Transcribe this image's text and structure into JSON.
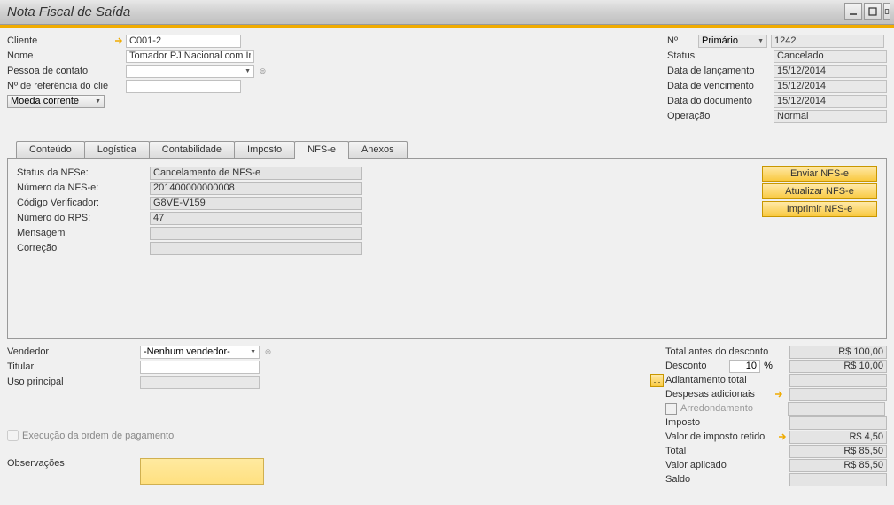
{
  "window": {
    "title": "Nota Fiscal de Saída"
  },
  "header_left": {
    "cliente": {
      "label": "Cliente",
      "value": "C001-2"
    },
    "nome": {
      "label": "Nome",
      "value": "Tomador PJ Nacional com Insc."
    },
    "pessoa": {
      "label": "Pessoa de contato",
      "value": ""
    },
    "ref": {
      "label": "Nº de referência do clie",
      "value": ""
    },
    "moeda": {
      "label": "Moeda corrente",
      "value": ""
    }
  },
  "header_right": {
    "numero": {
      "label": "Nº",
      "combo": "Primário",
      "value": "1242"
    },
    "status": {
      "label": "Status",
      "value": "Cancelado"
    },
    "data_lanc": {
      "label": "Data de lançamento",
      "value": "15/12/2014"
    },
    "data_venc": {
      "label": "Data de vencimento",
      "value": "15/12/2014"
    },
    "data_doc": {
      "label": "Data do documento",
      "value": "15/12/2014"
    },
    "operacao": {
      "label": "Operação",
      "value": "Normal"
    }
  },
  "tabs": {
    "conteudo": "Conteúdo",
    "logistica": "Logística",
    "contabilidade": "Contabilidade",
    "imposto": "Imposto",
    "nfse": "NFS-e",
    "anexos": "Anexos"
  },
  "nfse": {
    "status": {
      "label": "Status da NFSe:",
      "value": "Cancelamento de NFS-e"
    },
    "numero": {
      "label": "Número da NFS-e:",
      "value": "201400000000008"
    },
    "codigo": {
      "label": "Código Verificador:",
      "value": "G8VE-V159"
    },
    "rps": {
      "label": "Número do RPS:",
      "value": "47"
    },
    "mensagem": {
      "label": "Mensagem",
      "value": ""
    },
    "correcao": {
      "label": "Correção",
      "value": ""
    }
  },
  "nfse_buttons": {
    "enviar": "Enviar NFS-e",
    "atualizar": "Atualizar NFS-e",
    "imprimir": "Imprimir NFS-e"
  },
  "footer_left": {
    "vendedor": {
      "label": "Vendedor",
      "value": "-Nenhum vendedor-"
    },
    "titular": {
      "label": "Titular",
      "value": ""
    },
    "uso": {
      "label": "Uso principal",
      "value": ""
    },
    "ordem_pag": "Execução da ordem de pagamento",
    "obs": "Observações"
  },
  "totals": {
    "antes_desc": {
      "label": "Total antes do desconto",
      "value": "R$ 100,00"
    },
    "desconto": {
      "label": "Desconto",
      "pct": "10",
      "value": "R$ 10,00"
    },
    "adiantamento": {
      "label": "Adiantamento total",
      "value": ""
    },
    "despesas": {
      "label": "Despesas adicionais",
      "value": ""
    },
    "arredond": {
      "label": "Arredondamento",
      "value": ""
    },
    "imposto": {
      "label": "Imposto",
      "value": ""
    },
    "retido": {
      "label": "Valor de imposto retido",
      "value": "R$ 4,50"
    },
    "total": {
      "label": "Total",
      "value": "R$ 85,50"
    },
    "aplicado": {
      "label": "Valor aplicado",
      "value": "R$ 85,50"
    },
    "saldo": {
      "label": "Saldo",
      "value": ""
    }
  }
}
